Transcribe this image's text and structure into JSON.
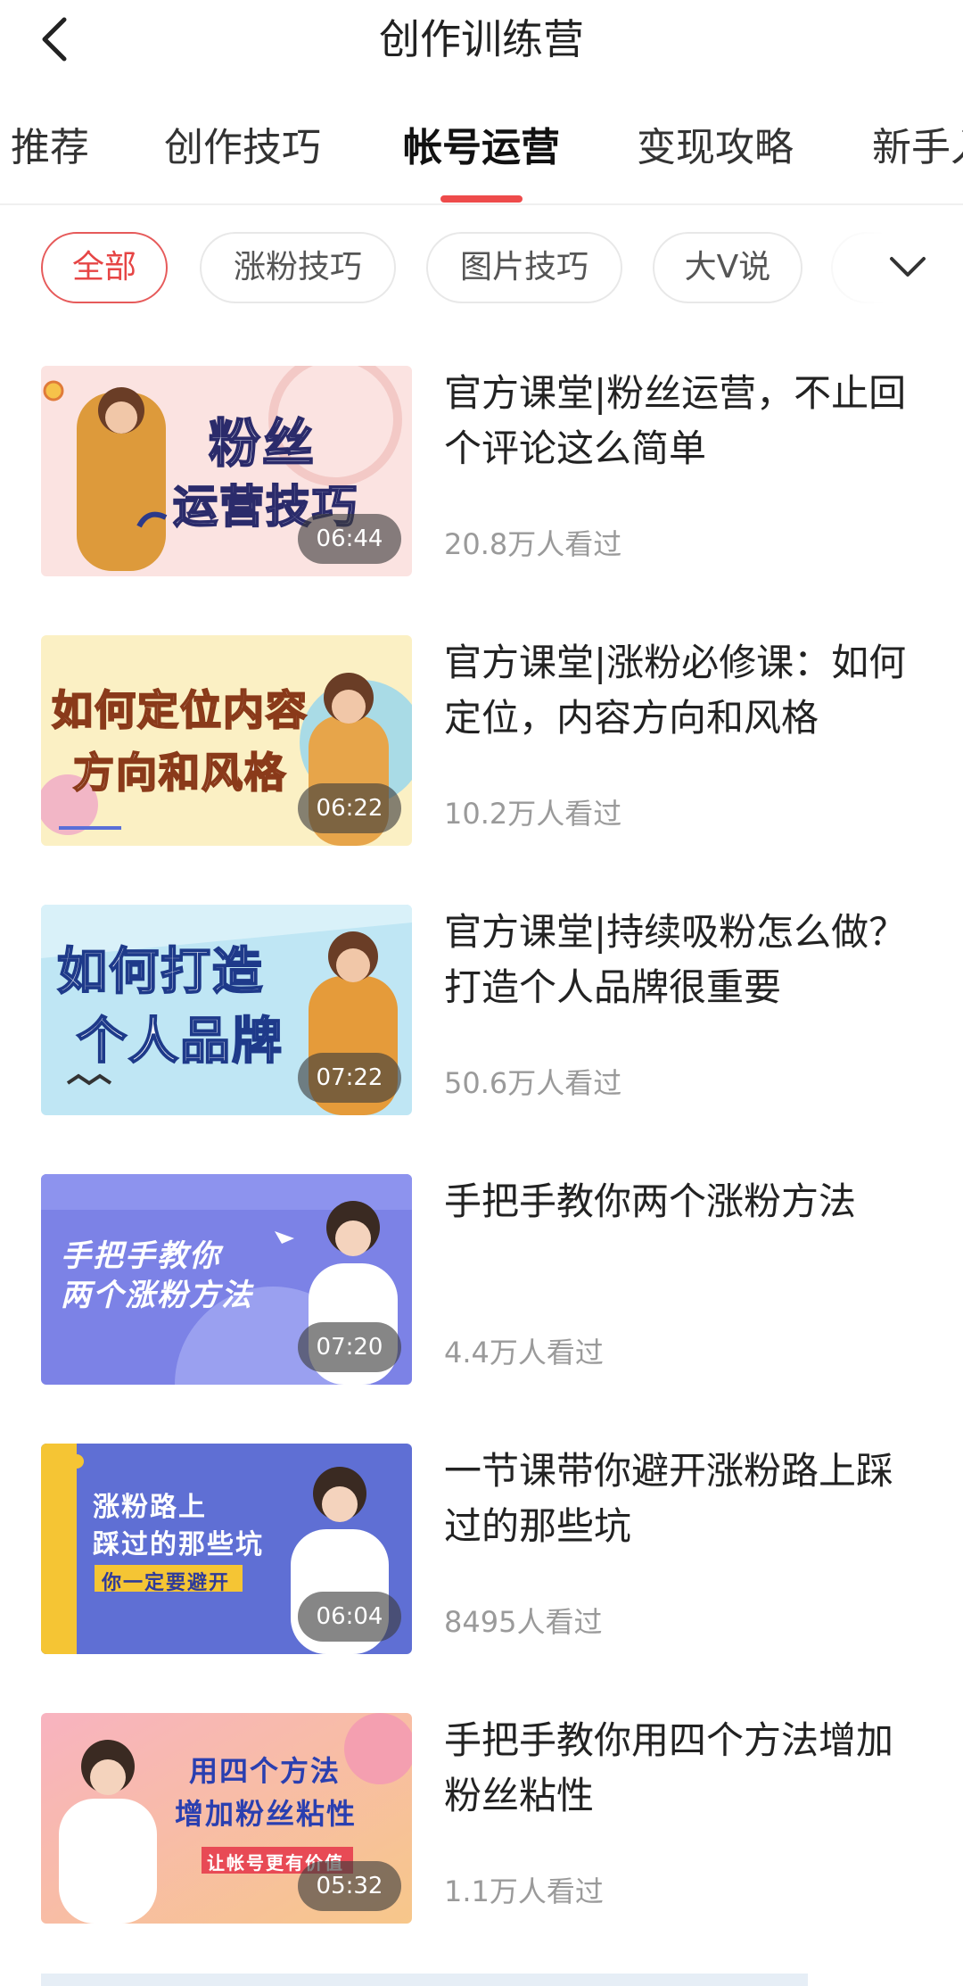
{
  "header": {
    "title": "创作训练营",
    "back_icon": "chevron-left-icon"
  },
  "tabs": [
    {
      "label": "推荐",
      "active": false
    },
    {
      "label": "创作技巧",
      "active": false
    },
    {
      "label": "帐号运营",
      "active": true
    },
    {
      "label": "变现攻略",
      "active": false
    },
    {
      "label": "新手入",
      "active": false
    }
  ],
  "filters": {
    "chips": [
      {
        "label": "全部",
        "active": true
      },
      {
        "label": "涨粉技巧",
        "active": false
      },
      {
        "label": "图片技巧",
        "active": false
      },
      {
        "label": "大V说",
        "active": false
      }
    ],
    "expand_icon": "chevron-down-icon"
  },
  "colors": {
    "accent": "#e64545",
    "underline": "#ee4b4b",
    "meta_text": "#9a9a9a"
  },
  "articles": [
    {
      "title": "官方课堂|粉丝运营，不止回个评论这么简单",
      "views": "20.8万人看过",
      "duration": "06:44",
      "thumb_text_1": "粉丝",
      "thumb_text_2": "运营技巧"
    },
    {
      "title": "官方课堂|涨粉必修课：如何定位，内容方向和风格",
      "views": "10.2万人看过",
      "duration": "06:22",
      "thumb_text_1": "如何定位内容",
      "thumb_text_2": "方向和风格"
    },
    {
      "title": "官方课堂|持续吸粉怎么做？打造个人品牌很重要",
      "views": "50.6万人看过",
      "duration": "07:22",
      "thumb_text_1": "如何打造",
      "thumb_text_2": "个人品牌"
    },
    {
      "title": "手把手教你两个涨粉方法",
      "views": "4.4万人看过",
      "duration": "07:20",
      "thumb_text_1": "手把手教你",
      "thumb_text_2": "两个涨粉方法"
    },
    {
      "title": "一节课带你避开涨粉路上踩过的那些坑",
      "views": "8495人看过",
      "duration": "06:04",
      "thumb_text_1": "涨粉路上",
      "thumb_text_2": "踩过的那些坑",
      "thumb_text_3": "你一定要避开"
    },
    {
      "title": "手把手教你用四个方法增加粉丝粘性",
      "views": "1.1万人看过",
      "duration": "05:32",
      "thumb_text_1": "用四个方法",
      "thumb_text_2": "增加粉丝粘性",
      "thumb_text_3": "让帐号更有价值"
    }
  ]
}
